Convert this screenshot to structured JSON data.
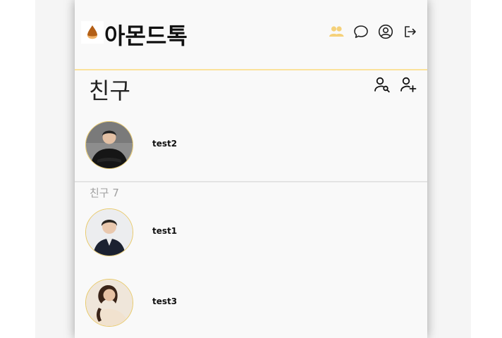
{
  "header": {
    "brand": "아몬드톡",
    "icons": [
      "friends-icon",
      "chat-icon",
      "profile-icon",
      "logout-icon"
    ],
    "accent_color": "#fbe29a"
  },
  "page": {
    "title": "친구",
    "actions": [
      "search-friend-icon",
      "add-friend-icon"
    ]
  },
  "my_profile": {
    "name": "test2"
  },
  "friends_section": {
    "label": "친구 7",
    "items": [
      {
        "name": "test1"
      },
      {
        "name": "test3"
      }
    ]
  }
}
